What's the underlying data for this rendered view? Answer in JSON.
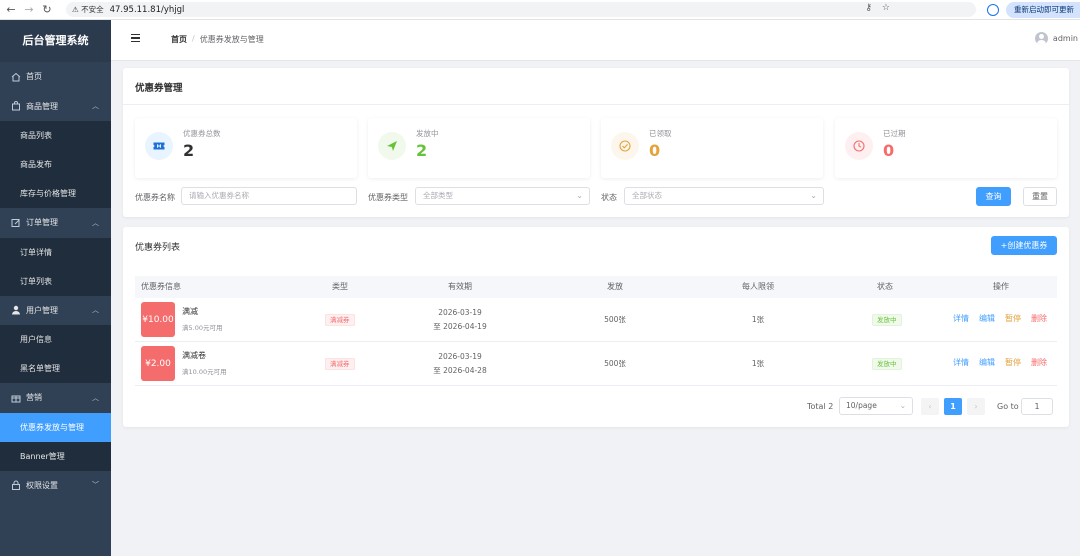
{
  "browser": {
    "insecure_label": "不安全",
    "url": "47.95.11.81/yhjgl",
    "update_label": "重新启动即可更新"
  },
  "sidebar": {
    "brand": "后台管理系统",
    "items": [
      {
        "label": "首页"
      },
      {
        "label": "商品管理",
        "children": [
          "商品列表",
          "商品发布",
          "库存与价格管理"
        ]
      },
      {
        "label": "订单管理",
        "children": [
          "订单详情",
          "订单列表"
        ]
      },
      {
        "label": "用户管理",
        "children": [
          "用户信息",
          "黑名单管理"
        ]
      },
      {
        "label": "营销",
        "children": [
          "优惠券发放与管理",
          "Banner管理"
        ]
      },
      {
        "label": "权限设置"
      }
    ],
    "active_item": "优惠券发放与管理"
  },
  "header": {
    "breadcrumb": [
      "首页",
      "优惠券发放与管理"
    ],
    "user": "admin"
  },
  "panel": {
    "title": "优惠券管理",
    "stats": [
      {
        "label": "优惠券总数",
        "value": "2",
        "color": "#303133",
        "icon_bg": "#e8f4ff",
        "icon_color": "#409eff",
        "icon": "ticket-icon"
      },
      {
        "label": "发放中",
        "value": "2",
        "color": "#67c23a",
        "icon_bg": "#f0f9eb",
        "icon_color": "#67c23a",
        "icon": "send-icon"
      },
      {
        "label": "已领取",
        "value": "0",
        "color": "#e6a23c",
        "icon_bg": "#fdf6ec",
        "icon_color": "#e6a23c",
        "icon": "check-circle-icon"
      },
      {
        "label": "已过期",
        "value": "0",
        "color": "#f56c6c",
        "icon_bg": "#fef0f0",
        "icon_color": "#f56c6c",
        "icon": "clock-icon"
      }
    ],
    "filters": {
      "name_label": "优惠券名称",
      "name_placeholder": "请输入优惠券名称",
      "type_label": "优惠券类型",
      "type_placeholder": "全部类型",
      "status_label": "状态",
      "status_placeholder": "全部状态",
      "search_button": "查询",
      "reset_button": "重置"
    }
  },
  "list": {
    "title": "优惠券列表",
    "create_button": "+创建优惠券",
    "columns": [
      "优惠券信息",
      "类型",
      "有效期",
      "发放",
      "每人限领",
      "状态",
      "操作"
    ],
    "rows": [
      {
        "amount": "¥10.00",
        "name": "满减",
        "desc": "满5.00元可用",
        "type": "满减券",
        "start": "2026-03-19",
        "end": "至 2026-04-19",
        "issued": "500张",
        "limit": "1张",
        "status": "发放中"
      },
      {
        "amount": "¥2.00",
        "name": "满减卷",
        "desc": "满10.00元可用",
        "type": "满减券",
        "start": "2026-03-19",
        "end": "至 2026-04-28",
        "issued": "500张",
        "limit": "1张",
        "status": "发放中"
      }
    ],
    "actions": [
      "详情",
      "编辑",
      "暂停",
      "删除"
    ],
    "pagination": {
      "total": "Total 2",
      "page_size": "10/page",
      "current_page": "1",
      "goto_label": "Go to",
      "goto_value": "1"
    }
  }
}
